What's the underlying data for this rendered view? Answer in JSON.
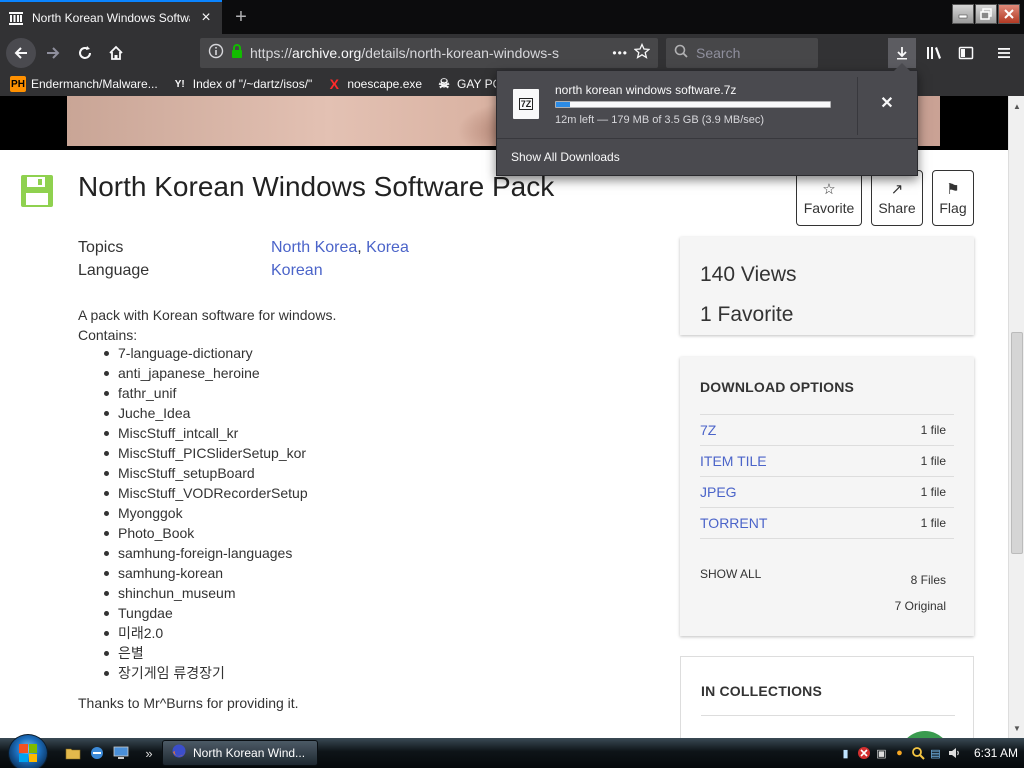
{
  "browser": {
    "tab_title": "North Korean Windows Software Pack",
    "tab_close": "×",
    "new_tab": "+",
    "url_prefix": "https://",
    "url_host": "archive.org",
    "url_path": "/details/north-korean-windows-s",
    "search_placeholder": "Search",
    "page_actions_glyph": "•••"
  },
  "bookmarks": [
    {
      "icon_text": "PH",
      "label": "Endermanch/Malware..."
    },
    {
      "icon_text": "Y!",
      "label": "Index of \"/~dartz/isos/\""
    },
    {
      "icon_text": "X",
      "label": "noescape.exe"
    },
    {
      "icon_text": "☠",
      "label": "GAY PORN"
    }
  ],
  "downloads_popup": {
    "filename": "north korean windows software.7z",
    "file_type": "7Z",
    "status": "12m left — 179 MB of 3.5 GB (3.9 MB/sec)",
    "progress_percent": 5,
    "cancel": "✕",
    "show_all": "Show All Downloads"
  },
  "item": {
    "title": "North Korean Windows Software Pack",
    "actions": [
      {
        "glyph": "☆",
        "label": "Favorite"
      },
      {
        "glyph": "↗",
        "label": "Share"
      },
      {
        "glyph": "⚑",
        "label": "Flag"
      }
    ],
    "meta": {
      "topics_label": "Topics",
      "topics": [
        "North Korea",
        "Korea"
      ],
      "topics_sep": ", ",
      "language_label": "Language",
      "language": "Korean"
    },
    "description_line1": "A pack with Korean software for windows.",
    "description_line2": "Contains:",
    "contents": [
      "7-language-dictionary",
      "anti_japanese_heroine",
      "fathr_unif",
      "Juche_Idea",
      "MiscStuff_intcall_kr",
      "MiscStuff_PICSliderSetup_kor",
      "MiscStuff_setupBoard",
      "MiscStuff_VODRecorderSetup",
      "Myonggok",
      "Photo_Book",
      "samhung-foreign-languages",
      "samhung-korean",
      "shinchun_museum",
      "Tungdae",
      "미래2.0",
      "은별",
      "장기게임 류경장기"
    ],
    "thanks": "Thanks to Mr^Burns for providing it."
  },
  "stats": {
    "views": "140 Views",
    "favorites": "1 Favorite"
  },
  "download_options": {
    "heading": "DOWNLOAD OPTIONS",
    "rows": [
      {
        "type": "7Z",
        "count": "1 file"
      },
      {
        "type": "ITEM TILE",
        "count": "1 file"
      },
      {
        "type": "JPEG",
        "count": "1 file"
      },
      {
        "type": "TORRENT",
        "count": "1 file"
      }
    ],
    "show_all": "SHOW ALL",
    "total_files": "8 Files",
    "original_files": "7 Original"
  },
  "collections": {
    "heading": "IN COLLECTIONS"
  },
  "taskbar": {
    "task_label": "North Korean Wind...",
    "clock": "6:31 AM",
    "overflow": "»"
  },
  "colors": {
    "accent_link": "#4b64c9",
    "firefox_dark": "#323234",
    "progress": "#2b8be6",
    "save_icon_green": "#8fd14f"
  }
}
